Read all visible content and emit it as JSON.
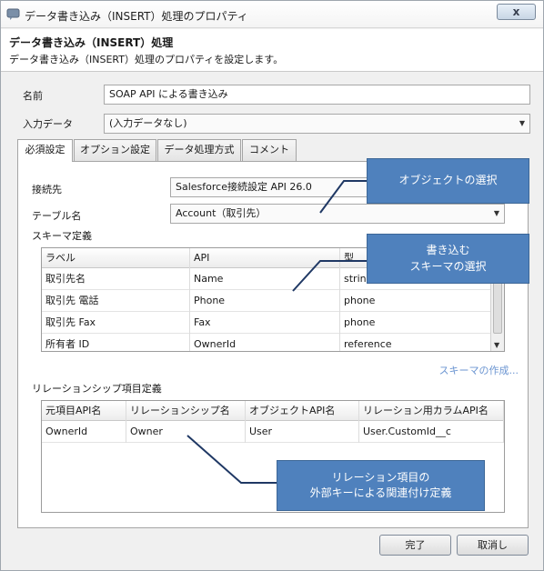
{
  "window": {
    "title": "データ書き込み（INSERT）処理のプロパティ",
    "close_symbol": "x"
  },
  "header": {
    "title": "データ書き込み（INSERT）処理",
    "description": "データ書き込み（INSERT）処理のプロパティを設定します。"
  },
  "form": {
    "name_label": "名前",
    "name_value": "SOAP API による書き込み",
    "input_label": "入力データ",
    "input_value": "(入力データなし)"
  },
  "tabs": [
    {
      "label": "必須設定"
    },
    {
      "label": "オプション設定"
    },
    {
      "label": "データ処理方式"
    },
    {
      "label": "コメント"
    }
  ],
  "required": {
    "connection_label": "接続先",
    "connection_value": "Salesforce接続設定 API 26.0",
    "table_label": "テーブル名",
    "table_value": "Account（取引先）",
    "schema_title": "スキーマ定義",
    "schema_columns": [
      "ラベル",
      "API",
      "型"
    ],
    "schema_rows": [
      [
        "取引先名",
        "Name",
        "string"
      ],
      [
        "取引先 電話",
        "Phone",
        "phone"
      ],
      [
        "取引先 Fax",
        "Fax",
        "phone"
      ],
      [
        "所有者 ID",
        "OwnerId",
        "reference"
      ]
    ],
    "schema_create_link": "スキーマの作成...",
    "relation_title": "リレーションシップ項目定義",
    "relation_columns": [
      "元項目API名",
      "リレーションシップ名",
      "オブジェクトAPI名",
      "リレーション用カラムAPI名"
    ],
    "relation_rows": [
      [
        "OwnerId",
        "Owner",
        "User",
        "User.CustomId__c"
      ]
    ]
  },
  "buttons": {
    "ok": "完了",
    "cancel": "取消し"
  },
  "callouts": {
    "object_select": "オブジェクトの選択",
    "schema_select_line1": "書き込む",
    "schema_select_line2": "スキーマの選択",
    "relation_line1": "リレーション項目の",
    "relation_line2": "外部キーによる関連付け定義"
  },
  "colors": {
    "callout": "#4f81bd",
    "link": "#6b95d1"
  }
}
